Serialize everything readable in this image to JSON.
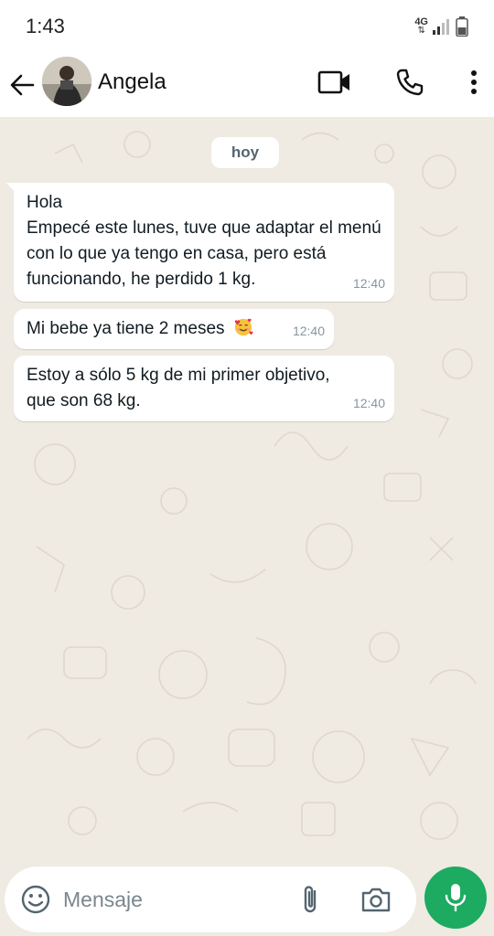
{
  "status_bar": {
    "time": "1:43",
    "network": "4G",
    "icons": [
      "network-4g-icon",
      "signal-icon",
      "battery-icon"
    ]
  },
  "header": {
    "contact_name": "Angela",
    "icons": [
      "back-arrow-icon",
      "video-call-icon",
      "phone-icon",
      "more-vert-icon"
    ]
  },
  "chat": {
    "date_label": "hoy",
    "messages": [
      {
        "text": "Hola\nEmpecé este lunes, tuve que adaptar el menú con lo que ya tengo en casa, pero está funcionando, he perdido 1 kg.",
        "time": "12:40"
      },
      {
        "text": "Mi bebe ya tiene 2 meses",
        "emoji": "smiling-face-with-hearts-emoji",
        "time": "12:40"
      },
      {
        "text": "Estoy a sólo 5 kg de mi primer objetivo,\nque son 68 kg.",
        "time": "12:40"
      }
    ]
  },
  "composer": {
    "placeholder": "Mensaje",
    "icons": [
      "emoji-icon",
      "attach-icon",
      "camera-icon",
      "mic-icon"
    ]
  },
  "colors": {
    "chat_background": "#efeae2",
    "bubble": "#ffffff",
    "accent_green": "#1daa61",
    "timestamp": "#8696a0"
  }
}
